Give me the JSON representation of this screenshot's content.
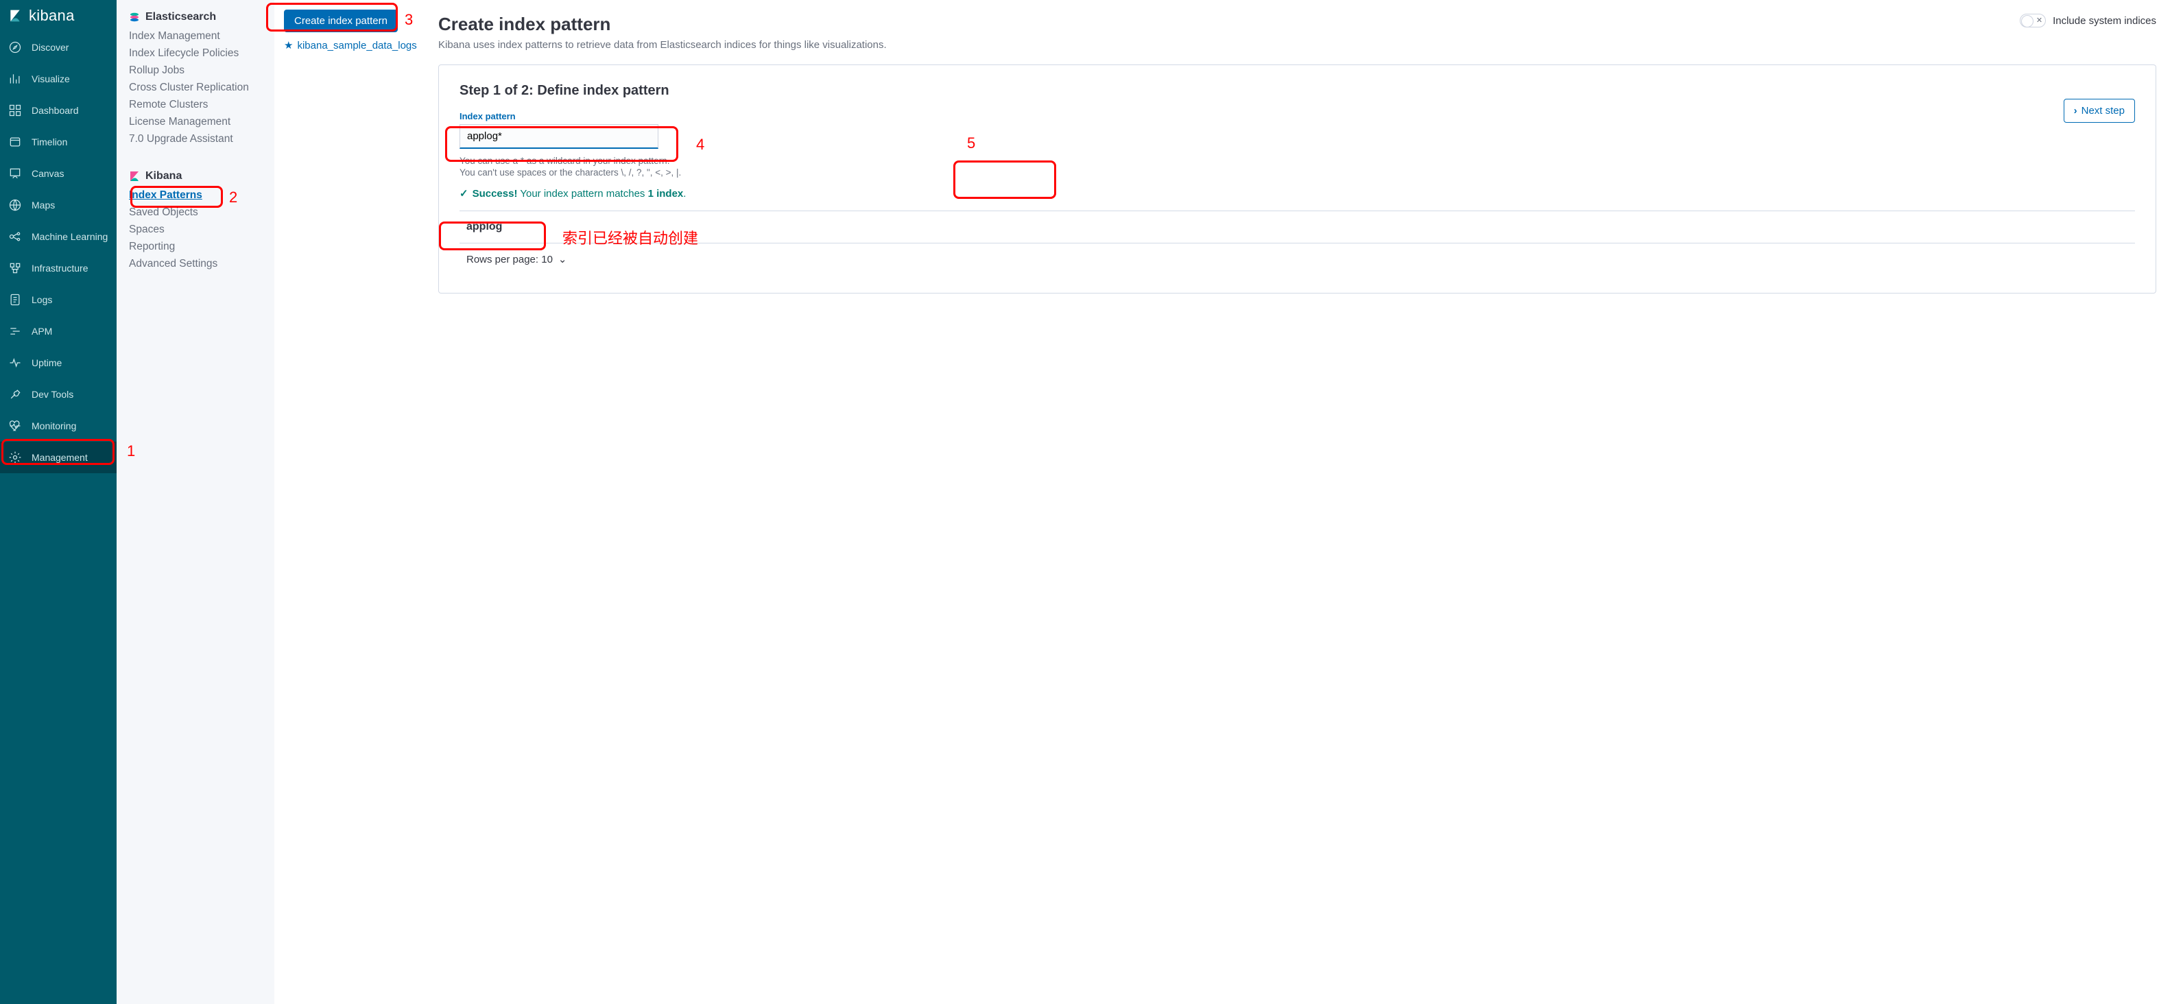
{
  "brand": {
    "name": "kibana"
  },
  "nav": {
    "items": [
      {
        "label": "Discover"
      },
      {
        "label": "Visualize"
      },
      {
        "label": "Dashboard"
      },
      {
        "label": "Timelion"
      },
      {
        "label": "Canvas"
      },
      {
        "label": "Maps"
      },
      {
        "label": "Machine Learning"
      },
      {
        "label": "Infrastructure"
      },
      {
        "label": "Logs"
      },
      {
        "label": "APM"
      },
      {
        "label": "Uptime"
      },
      {
        "label": "Dev Tools"
      },
      {
        "label": "Monitoring"
      },
      {
        "label": "Management"
      }
    ]
  },
  "mgmt": {
    "es_header": "Elasticsearch",
    "es_links": [
      "Index Management",
      "Index Lifecycle Policies",
      "Rollup Jobs",
      "Cross Cluster Replication",
      "Remote Clusters",
      "License Management",
      "7.0 Upgrade Assistant"
    ],
    "kb_header": "Kibana",
    "kb_links": [
      "Index Patterns",
      "Saved Objects",
      "Spaces",
      "Reporting",
      "Advanced Settings"
    ]
  },
  "idxlist": {
    "create_button": "Create index pattern",
    "entries": [
      "kibana_sample_data_logs"
    ]
  },
  "page": {
    "title": "Create index pattern",
    "subtitle": "Kibana uses index patterns to retrieve data from Elasticsearch indices for things like visualizations.",
    "include_system": "Include system indices",
    "step_title": "Step 1 of 2: Define index pattern",
    "field_label": "Index pattern",
    "input_value": "applog*",
    "hint1": "You can use a * as a wildcard in your index pattern.",
    "hint2": "You can't use spaces or the characters \\, /, ?, \", <, >, |.",
    "success_lead": "Success!",
    "success_rest": " Your index pattern matches 1 index.",
    "next_button": "Next step",
    "match_value": "applog",
    "rows_per_page": "Rows per page: 10"
  },
  "anno": {
    "n1": "1",
    "n2": "2",
    "n3": "3",
    "n4": "4",
    "n5": "5",
    "chinese": "索引已经被自动创建"
  }
}
